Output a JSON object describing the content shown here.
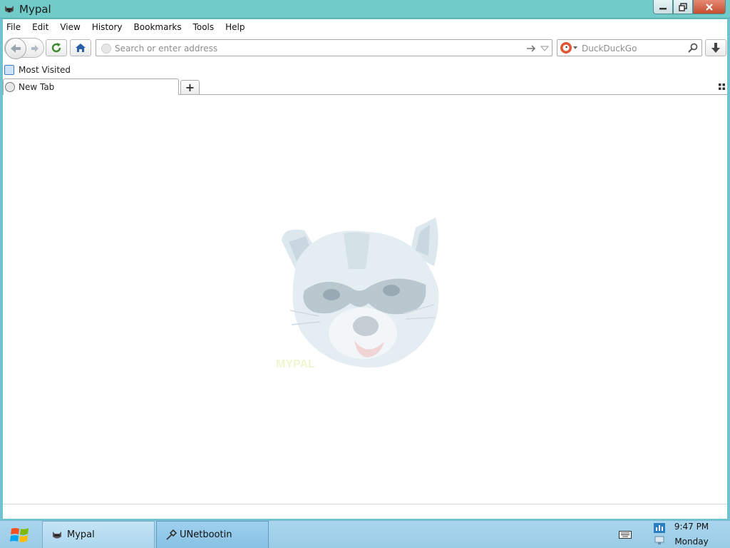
{
  "window": {
    "title": "Mypal",
    "controls": {
      "minimize_icon": "minimize-icon",
      "maximize_icon": "restore-icon",
      "close_icon": "close-icon"
    }
  },
  "menubar": {
    "items": [
      "File",
      "Edit",
      "View",
      "History",
      "Bookmarks",
      "Tools",
      "Help"
    ]
  },
  "navbar": {
    "back_icon": "back-arrow-icon",
    "forward_icon": "forward-arrow-icon",
    "reload_icon": "reload-icon",
    "home_icon": "home-icon",
    "address_placeholder": "Search or enter address",
    "address_value": "",
    "search_engine_icon": "duckduckgo-icon",
    "search_placeholder": "DuckDuckGo",
    "search_value": "",
    "download_icon": "download-arrow-icon"
  },
  "bookmarks": {
    "items": [
      {
        "label": "Most Visited",
        "icon": "bookmark-folder-icon"
      }
    ]
  },
  "tabs": {
    "items": [
      {
        "label": "New Tab",
        "icon": "globe-icon",
        "active": true
      }
    ],
    "new_tab_label": "+"
  },
  "content": {
    "image": "mypal-raccoon-logo"
  },
  "taskbar": {
    "start_icon": "windows-start-icon",
    "tasks": [
      {
        "label": "Mypal",
        "icon": "mypal-raccoon-icon",
        "active": false
      },
      {
        "label": "UNetbootin",
        "icon": "unetbootin-icon",
        "active": true
      }
    ],
    "clock": {
      "time": "9:47 PM",
      "day": "Monday"
    }
  },
  "colors": {
    "titlebar": "#71ccc9",
    "close_button": "#c54c2f",
    "taskbar": "#a9d6ee",
    "reload_green": "#3a8a2b",
    "home_blue": "#2a5ea8"
  }
}
